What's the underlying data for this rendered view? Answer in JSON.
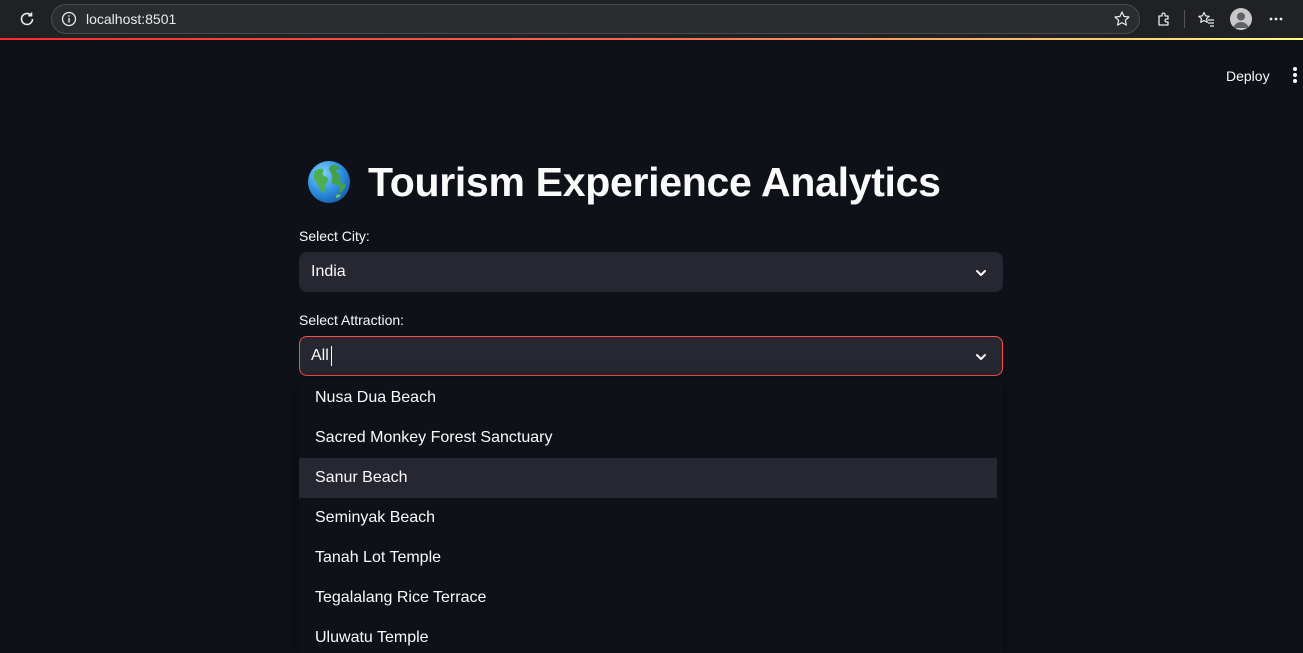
{
  "browser": {
    "url": "localhost:8501"
  },
  "header": {
    "deploy_label": "Deploy"
  },
  "page": {
    "title_icon": "globe-emoji",
    "title": "Tourism Experience Analytics"
  },
  "city_select": {
    "label": "Select City:",
    "value": "India"
  },
  "attraction_select": {
    "label": "Select Attraction:",
    "value": "All",
    "options": [
      "Nusa Dua Beach",
      "Sacred Monkey Forest Sanctuary",
      "Sanur Beach",
      "Seminyak Beach",
      "Tanah Lot Temple",
      "Tegalalang Rice Terrace",
      "Uluwatu Temple"
    ],
    "highlighted": "Sanur Beach"
  },
  "colors": {
    "background": "#0e1117",
    "input_bg": "#262730",
    "focus_border": "#ff4b4b"
  }
}
